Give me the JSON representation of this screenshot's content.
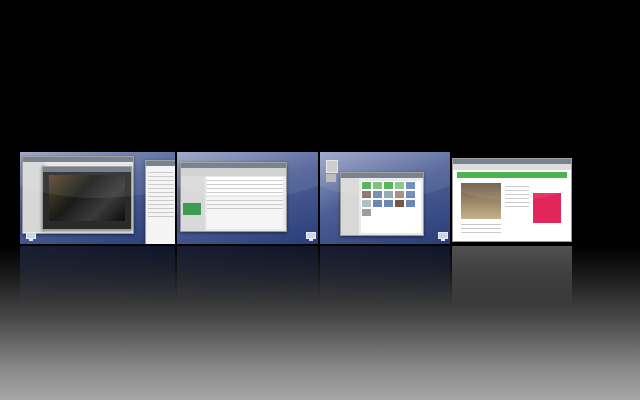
{
  "switcher": {
    "workspaces": [
      {
        "apps": [
          "video-player-window",
          "file-manager-window",
          "chat-window"
        ]
      },
      {
        "apps": [
          "email-client-window"
        ]
      },
      {
        "apps": [
          "photo-browser-window"
        ]
      },
      {
        "apps": [
          "web-browser-window"
        ]
      }
    ],
    "colors": {
      "desktop_top": "#9aa6c8",
      "desktop_bottom": "#2b3d78",
      "window_bg": "#e9e9e9",
      "browser_green": "#3fae3f",
      "browser_ad_pink": "#e2265a"
    }
  }
}
